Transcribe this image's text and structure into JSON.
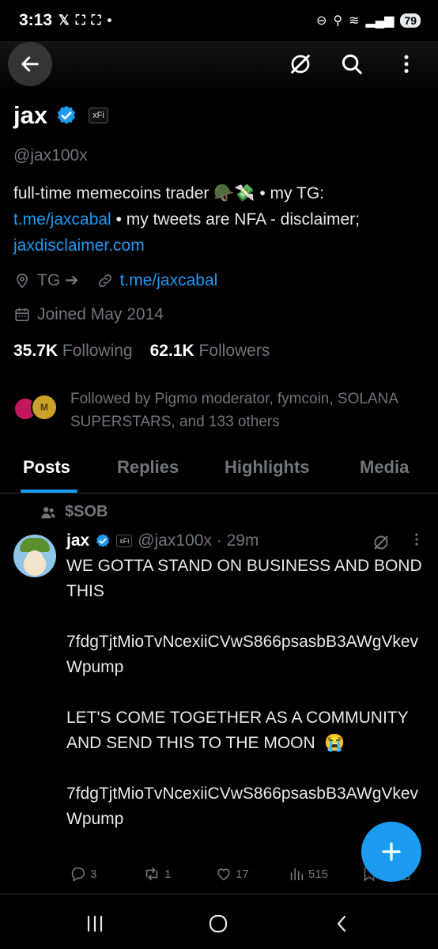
{
  "status_bar": {
    "time": "3:13",
    "icons_left": [
      "x-logo-icon",
      "screenshot-icon",
      "screenshot-icon",
      "dot"
    ],
    "battery": "79"
  },
  "profile": {
    "name": "jax",
    "affiliate_badge": "xFi",
    "handle": "@jax100x",
    "bio_part1": "full-time memecoins trader 🪖💸  • my TG: ",
    "bio_link1": "t.me/jaxcabal",
    "bio_part2": " •  my tweets are NFA - disclaimer; ",
    "bio_link2": "jaxdisclaimer.com",
    "location": "TG ➔",
    "website": "t.me/jaxcabal",
    "joined": "Joined May 2014",
    "following_count": "35.7K",
    "following_label": "Following",
    "followers_count": "62.1K",
    "followers_label": "Followers",
    "followed_by": "Followed by Pigmo moderator, fymcoin, SOLANA SUPERSTARS, and 133 others"
  },
  "tabs": [
    {
      "label": "Posts",
      "active": true
    },
    {
      "label": "Replies",
      "active": false
    },
    {
      "label": "Highlights",
      "active": false
    },
    {
      "label": "Media",
      "active": false
    }
  ],
  "post": {
    "community": "$SOB",
    "author": "jax",
    "affiliate_badge": "xFi",
    "handle_time": "@jax100x · 29m",
    "text": "WE GOTTA STAND ON BUSINESS AND BOND THIS\n\n7fdgTjtMioTvNcexiiCVwS866psasbB3AWgVkevWpump\n\nLET'S COME TOGETHER AS A COMMUNITY AND SEND THIS TO THE MOON  😭\n\n7fdgTjtMioTvNcexiiCVwS866psasbB3AWgVkevWpump",
    "replies": "3",
    "reposts": "1",
    "likes": "17",
    "views": "515"
  },
  "colors": {
    "accent": "#1d9bf0",
    "muted": "#71767b",
    "background": "#000000"
  }
}
